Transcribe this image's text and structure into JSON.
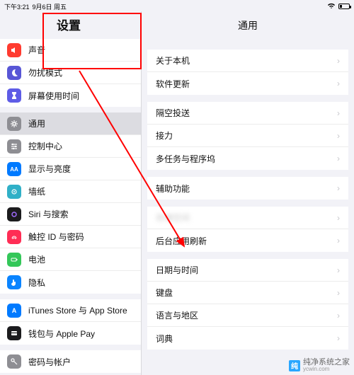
{
  "status": {
    "time": "下午3:21",
    "date": "9月6日 周五"
  },
  "sidebar": {
    "title": "设置",
    "groups": [
      {
        "items": [
          {
            "id": "sound",
            "label": "声音"
          },
          {
            "id": "dnd",
            "label": "勿扰模式"
          },
          {
            "id": "screentime",
            "label": "屏幕使用时间"
          }
        ]
      },
      {
        "items": [
          {
            "id": "general",
            "label": "通用",
            "selected": true
          },
          {
            "id": "control",
            "label": "控制中心"
          },
          {
            "id": "display",
            "label": "显示与亮度"
          },
          {
            "id": "wallpaper",
            "label": "墙纸"
          },
          {
            "id": "siri",
            "label": "Siri 与搜索"
          },
          {
            "id": "touchid",
            "label": "触控 ID 与密码"
          },
          {
            "id": "battery",
            "label": "电池"
          },
          {
            "id": "privacy",
            "label": "隐私"
          }
        ]
      },
      {
        "items": [
          {
            "id": "appstore",
            "label": "iTunes Store 与 App Store"
          },
          {
            "id": "wallet",
            "label": "钱包与 Apple Pay"
          }
        ]
      },
      {
        "items": [
          {
            "id": "passwords",
            "label": "密码与帐户"
          }
        ]
      }
    ]
  },
  "detail": {
    "title": "通用",
    "groups": [
      {
        "rows": [
          {
            "label": "关于本机"
          },
          {
            "label": "软件更新"
          }
        ]
      },
      {
        "rows": [
          {
            "label": "隔空投送"
          },
          {
            "label": "接力"
          },
          {
            "label": "多任务与程序坞"
          }
        ]
      },
      {
        "rows": [
          {
            "label": "辅助功能"
          }
        ]
      },
      {
        "rows": [
          {
            "label": "存储空间",
            "blur": true
          },
          {
            "label": "后台应用刷新"
          }
        ]
      },
      {
        "rows": [
          {
            "label": "日期与时间"
          },
          {
            "label": "键盘"
          },
          {
            "label": "语言与地区"
          },
          {
            "label": "词典"
          }
        ]
      }
    ]
  },
  "watermark": {
    "logo": "纯",
    "text": "纯净系统之家",
    "url": "ycwin.com"
  }
}
